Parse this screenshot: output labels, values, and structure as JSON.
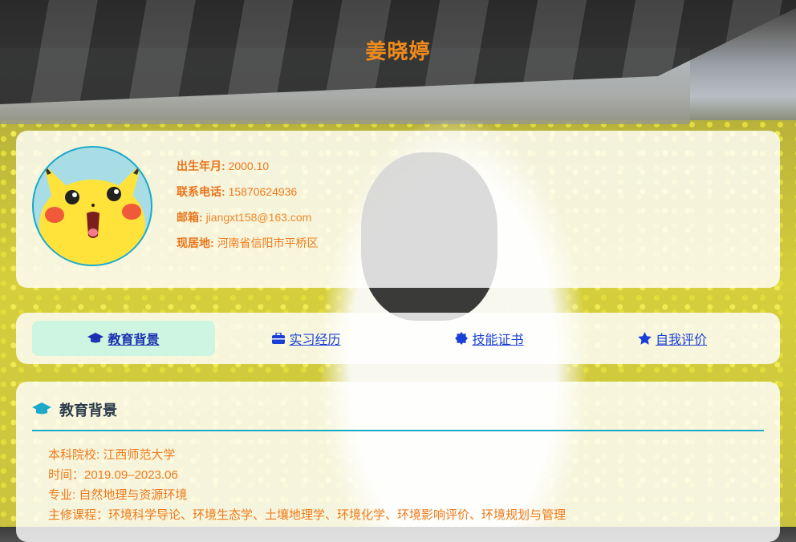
{
  "page": {
    "name": "姜晓婷"
  },
  "profile": {
    "birth": {
      "label": "出生年月:",
      "value": "2000.10"
    },
    "phone": {
      "label": "联系电话:",
      "value": "15870624936"
    },
    "email": {
      "label": "邮箱:",
      "value": "jiangxt158@163.com"
    },
    "location": {
      "label": "现居地:",
      "value": "河南省信阳市平桥区"
    }
  },
  "nav": {
    "items": [
      {
        "label": "教育背景",
        "icon": "graduation-cap-icon"
      },
      {
        "label": "实习经历",
        "icon": "briefcase-icon"
      },
      {
        "label": "技能证书",
        "icon": "certificate-icon"
      },
      {
        "label": "自我评价",
        "icon": "star-icon"
      }
    ]
  },
  "education": {
    "heading": "教育背景",
    "school": "本科院校: 江西师范大学",
    "time": "时间：2019.09–2023.06",
    "major": "专业: 自然地理与资源环境",
    "courses": "主修课程：环境科学导论、环境生态学、土壤地理学、环境化学、环境影响评价、环境规划与管理"
  },
  "colors": {
    "accent": "#f08a1c",
    "link": "#1a3fd6",
    "divider": "#1aa9c9"
  }
}
